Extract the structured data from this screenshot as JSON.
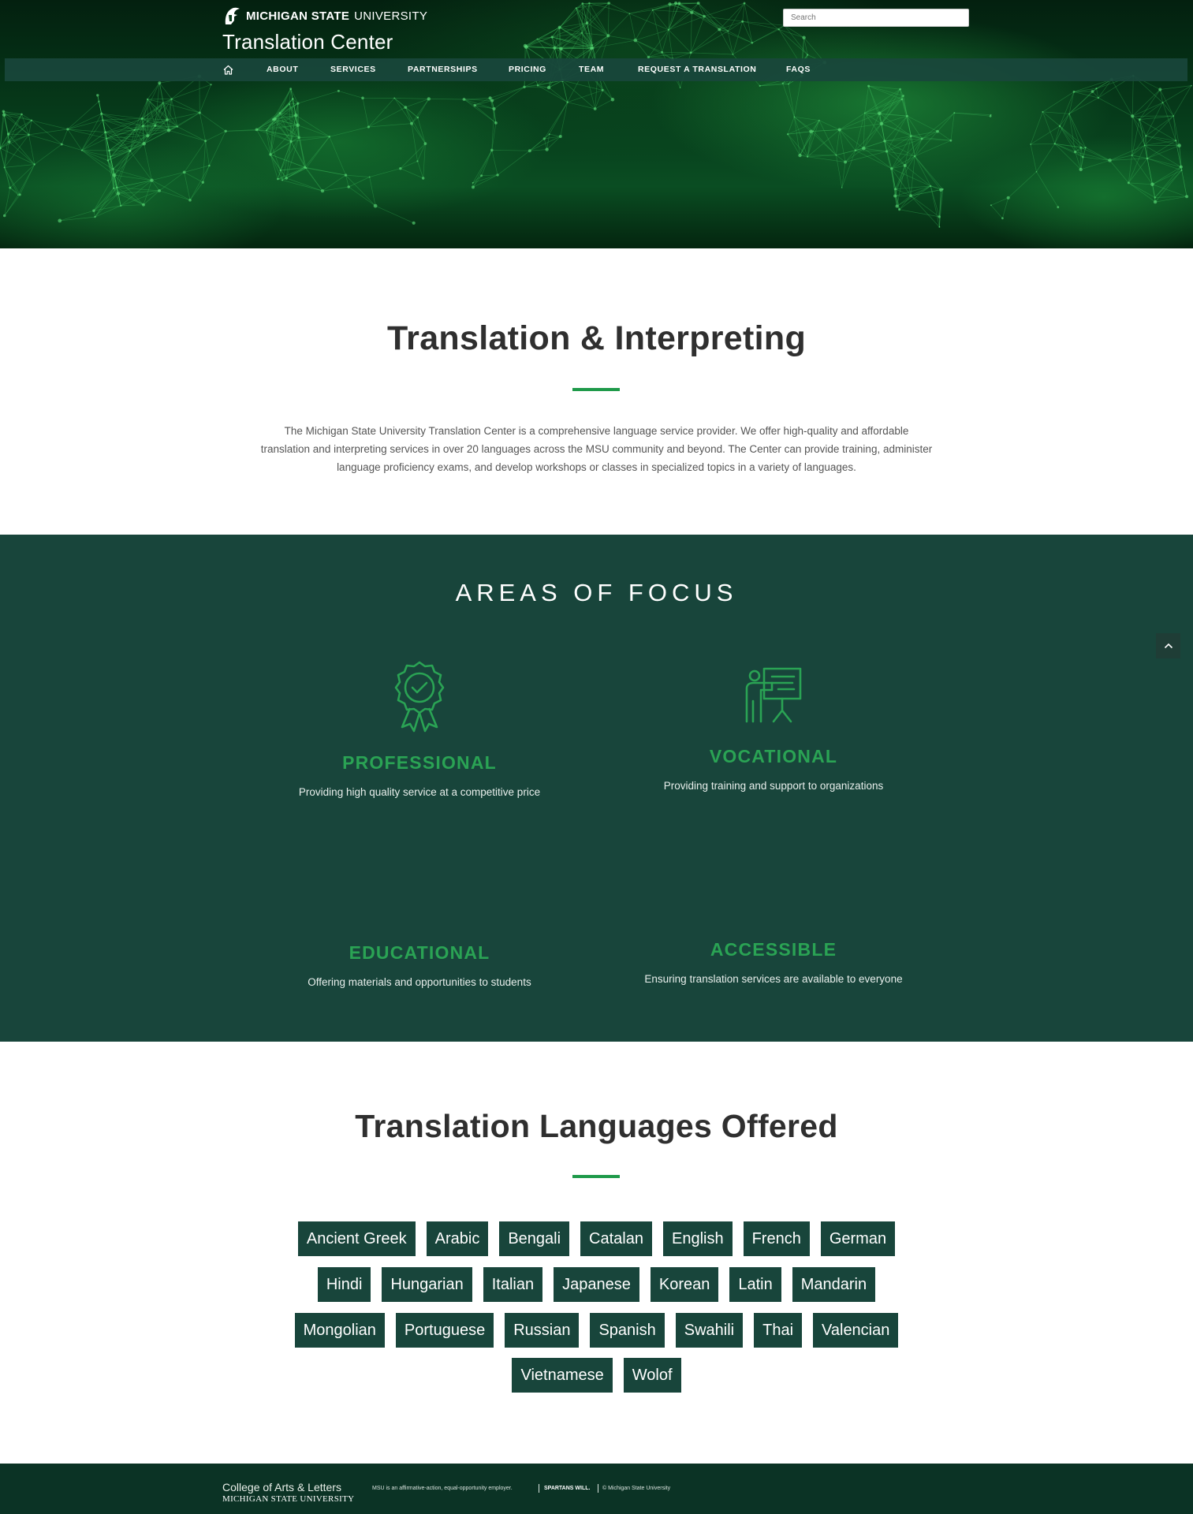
{
  "header": {
    "msu_logo_bold": "MICHIGAN STATE",
    "msu_logo_light": "UNIVERSITY",
    "site_title": "Translation Center",
    "search_placeholder": "Search"
  },
  "nav": {
    "home_icon": "home-icon",
    "items": [
      "ABOUT",
      "SERVICES",
      "PARTNERSHIPS",
      "PRICING",
      "TEAM",
      "REQUEST A TRANSLATION",
      "FAQS"
    ]
  },
  "intro": {
    "title": "Translation & Interpreting",
    "text": "The Michigan State University Translation Center is a comprehensive language service provider. We offer high-quality and affordable translation and interpreting services in over 20 languages across the MSU community and beyond. The Center can provide training, administer language proficiency exams, and develop workshops or classes in specialized topics in a variety of languages."
  },
  "focus": {
    "title": "AREAS OF FOCUS",
    "cards": [
      {
        "title": "PROFESSIONAL",
        "desc": "Providing high quality service at a competitive price",
        "icon": "award-ribbon-icon"
      },
      {
        "title": "VOCATIONAL",
        "desc": "Providing training and support to organizations",
        "icon": "presenter-board-icon"
      },
      {
        "title": "EDUCATIONAL",
        "desc": "Offering materials and opportunities to students",
        "icon": ""
      },
      {
        "title": "ACCESSIBLE",
        "desc": "Ensuring translation services are available to everyone",
        "icon": ""
      }
    ]
  },
  "languages": {
    "title": "Translation Languages Offered",
    "rows": [
      [
        "Ancient Greek",
        "Arabic",
        "Bengali",
        "Catalan",
        "English",
        "French",
        "German"
      ],
      [
        "Hindi",
        "Hungarian",
        "Italian",
        "Japanese",
        "Korean",
        "Latin",
        "Mandarin"
      ],
      [
        "Mongolian",
        "Portuguese",
        "Russian",
        "Spanish",
        "Swahili",
        "Thai",
        "Valencian"
      ],
      [
        "Vietnamese",
        "Wolof"
      ]
    ]
  },
  "footer": {
    "college": "College of Arts & Letters",
    "university": "MICHIGAN STATE UNIVERSITY",
    "employer_note": "MSU is an affirmative-action, equal-opportunity employer.",
    "spartans": "SPARTANS WILL.",
    "copyright": "© Michigan State University"
  },
  "colors": {
    "msu_green": "#18453b",
    "accent_green": "#2aa354",
    "footer_green": "#0b3325"
  },
  "back_to_top_icon": "chevron-up-icon"
}
